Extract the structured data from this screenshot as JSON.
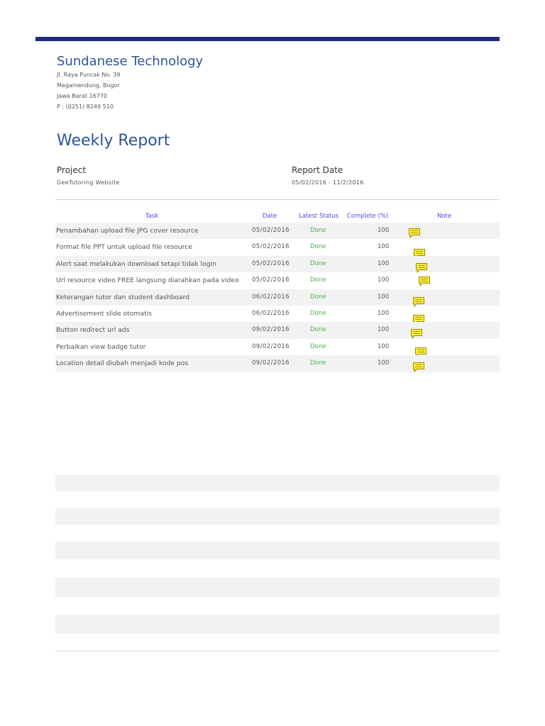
{
  "company": {
    "name": "Sundanese Technology",
    "address_lines": [
      "Jl. Raya Puncak No. 39",
      "Megamendung, Bogor",
      "Jawa Barat 16770",
      "P : (0251) 8249 510"
    ]
  },
  "report_title": "Weekly Report",
  "project": {
    "label": "Project",
    "value": "GeeTutoring Website"
  },
  "report_date": {
    "label": "Report Date",
    "value": "05/02/2016 - 11/2/2016"
  },
  "table": {
    "headers": {
      "task": "Task",
      "date": "Date",
      "status": "Latest Status",
      "complete": "Complete (%)",
      "note": "Note"
    },
    "rows": [
      {
        "task": "Penambahan upload file JPG cover resource",
        "date": "05/02/2016",
        "status": "Done",
        "complete": "100"
      },
      {
        "task": "Format file PPT untuk upload file resource",
        "date": "05/02/2016",
        "status": "Done",
        "complete": "100"
      },
      {
        "task": "Alert saat melakukan download tetapi tidak login",
        "date": "05/02/2016",
        "status": "Done",
        "complete": "100"
      },
      {
        "task": "Url resource video FREE langsung diarahkan pada video",
        "date": "05/02/2016",
        "status": "Done",
        "complete": "100"
      },
      {
        "task": "Keterangan tutor dan student dashboard",
        "date": "06/02/2016",
        "status": "Done",
        "complete": "100"
      },
      {
        "task": "Advertisement slide  otomatis",
        "date": "06/02/2016",
        "status": "Done",
        "complete": "100"
      },
      {
        "task": "Button redirect url ads",
        "date": "09/02/2016",
        "status": "Done",
        "complete": "100"
      },
      {
        "task": "Perbaikan view badge tutor",
        "date": "09/02/2016",
        "status": "Done",
        "complete": "100"
      },
      {
        "task": "Location detail diubah menjadi kode pos",
        "date": "09/02/2016",
        "status": "Done",
        "complete": "100"
      }
    ]
  },
  "colors": {
    "accent_bar": "#1f2a80",
    "heading": "#2f5597",
    "header_text": "#4a4adf",
    "status_done": "#4caf50",
    "note_icon": "#ffef3a"
  },
  "icons": {
    "note": "speech-bubble-note-icon"
  }
}
